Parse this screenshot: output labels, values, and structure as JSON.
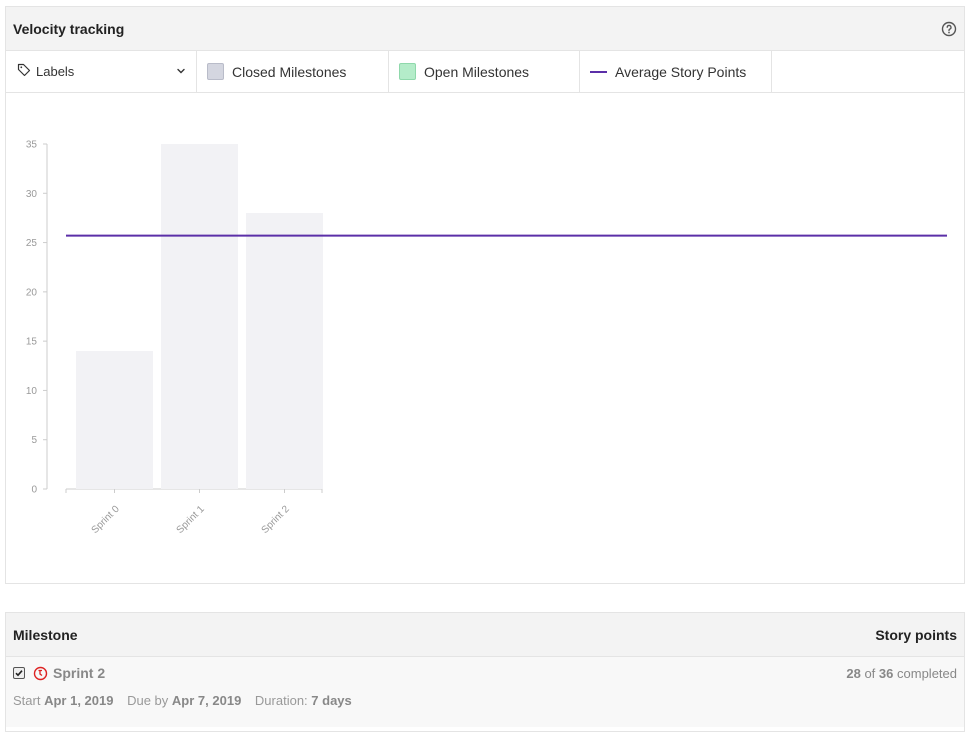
{
  "header": {
    "title": "Velocity tracking",
    "help_icon": "help-circle-icon"
  },
  "legend": {
    "select_label": "Labels",
    "closed_label": "Closed Milestones",
    "open_label": "Open Milestones",
    "average_label": "Average Story Points",
    "closed_color": "#d4d6e0",
    "open_color": "#b4ecc9",
    "average_color": "#5b2fa8"
  },
  "chart_data": {
    "type": "bar",
    "categories": [
      "Sprint 0",
      "Sprint 1",
      "Sprint 2"
    ],
    "series": [
      {
        "values": [
          14,
          35,
          28
        ]
      }
    ],
    "average": 25.7,
    "ylim": [
      0,
      35
    ],
    "yticks": [
      0,
      5,
      10,
      15,
      20,
      25,
      30,
      35
    ],
    "bar_color": "#f2f2f5",
    "line_color": "#5b2fa8"
  },
  "table": {
    "col_milestone": "Milestone",
    "col_points": "Story points",
    "rows": [
      {
        "name": "Sprint 2",
        "done": "28",
        "total": "36",
        "of": "of",
        "completed": "completed",
        "start_label": "Start",
        "start": "Apr 1, 2019",
        "due_label": "Due by",
        "due": "Apr 7, 2019",
        "duration_label": "Duration:",
        "duration": "7 days"
      }
    ]
  }
}
